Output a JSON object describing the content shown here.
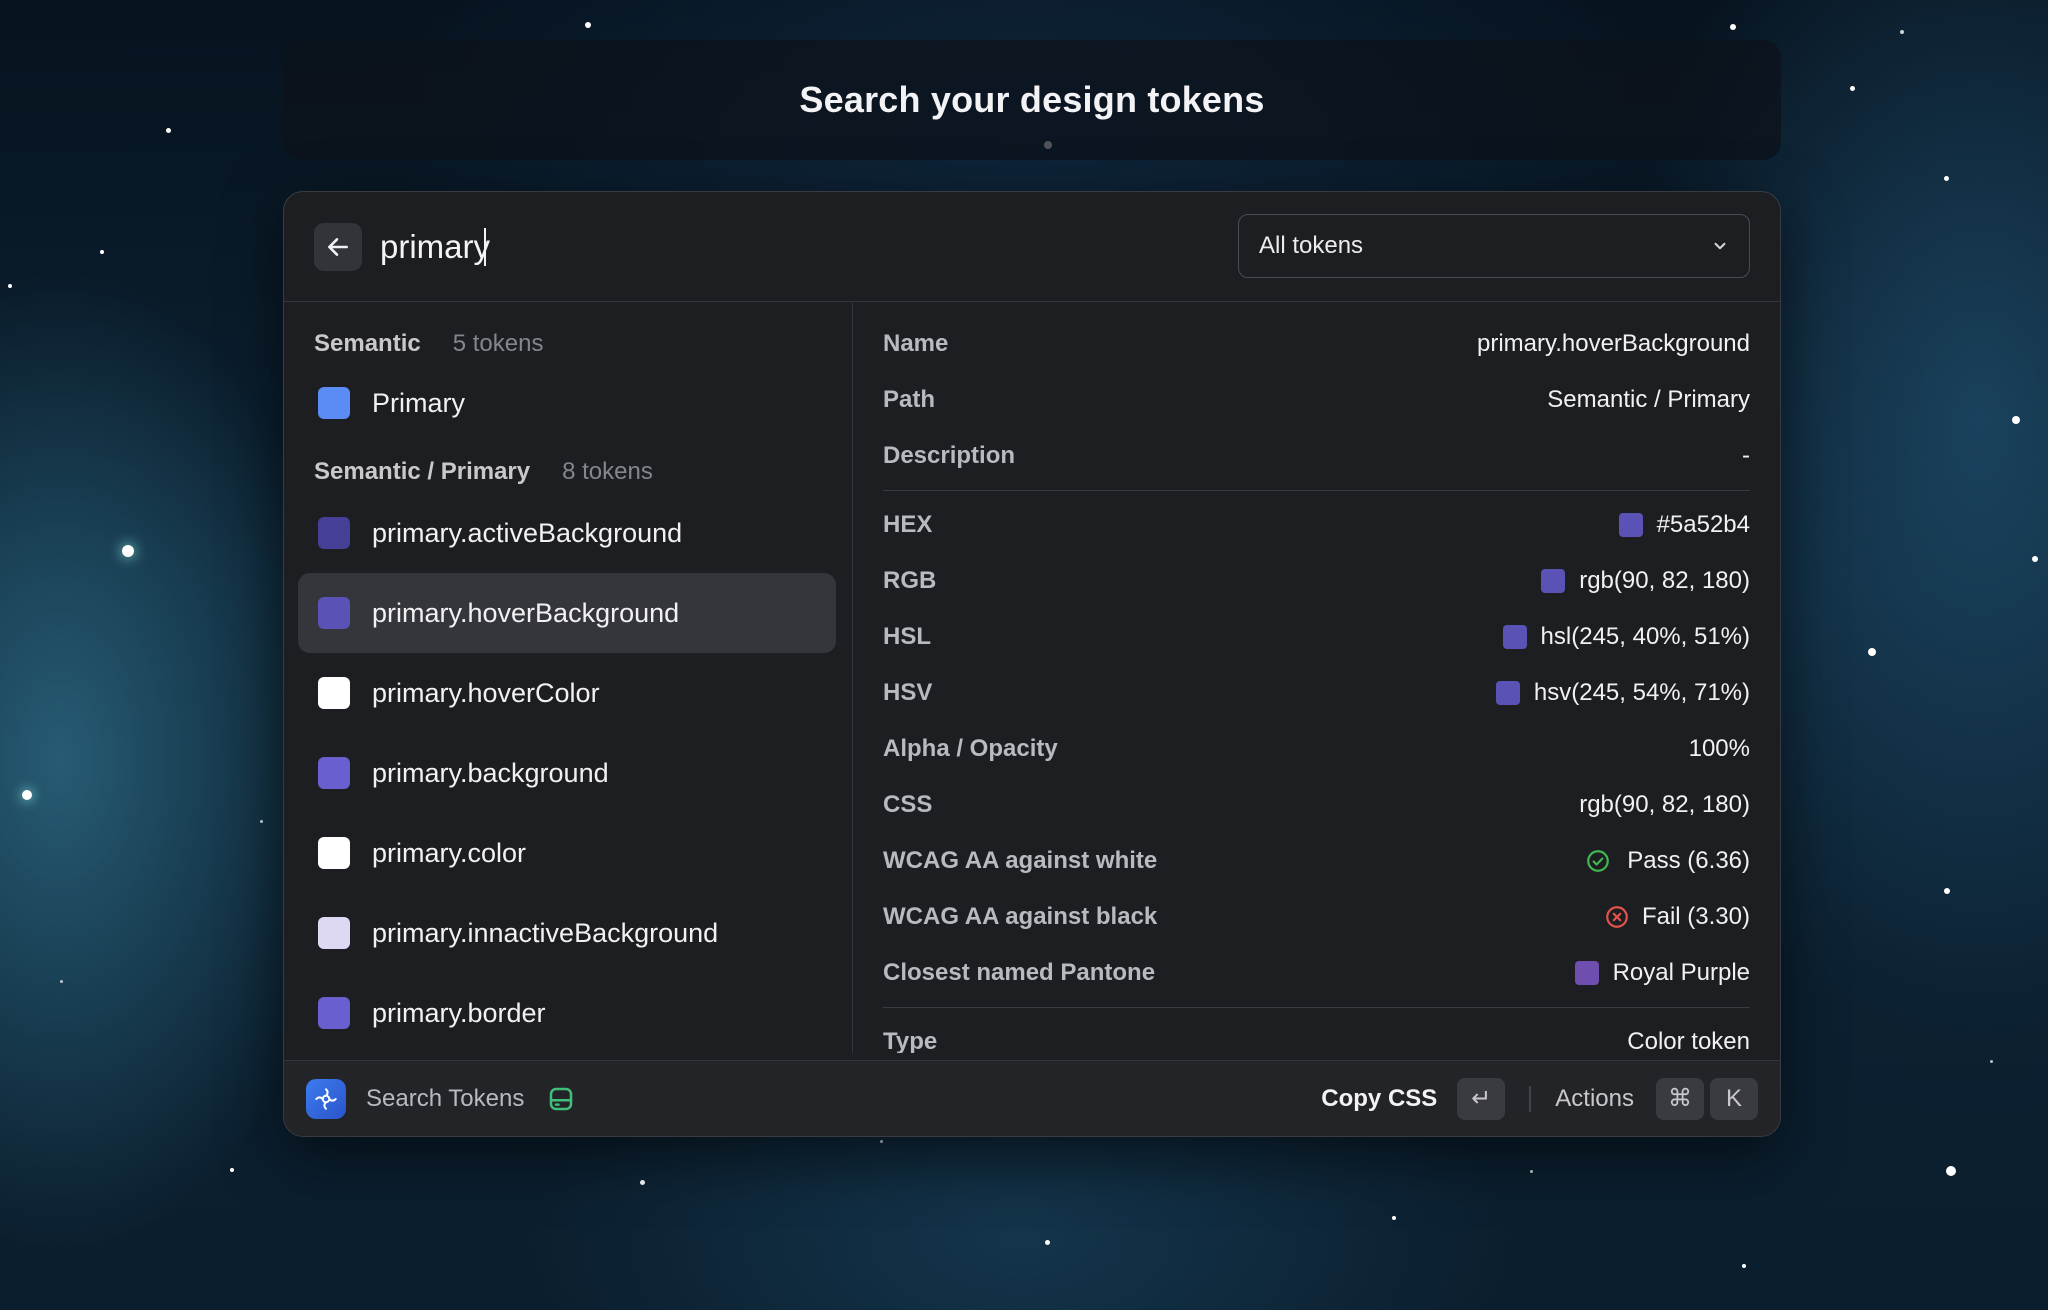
{
  "title": "Search your design tokens",
  "search": {
    "value": "primary"
  },
  "filter": {
    "selected": "All tokens",
    "icon": "chevron-down-icon"
  },
  "groups": [
    {
      "name": "Semantic",
      "count": "5 tokens",
      "items": [
        {
          "label": "Primary",
          "color": "#5b8bf5"
        }
      ]
    },
    {
      "name": "Semantic / Primary",
      "count": "8 tokens",
      "items": [
        {
          "label": "primary.activeBackground",
          "color": "#463f96"
        },
        {
          "label": "primary.hoverBackground",
          "color": "#5a52b4",
          "selected": true
        },
        {
          "label": "primary.hoverColor",
          "color": "#ffffff"
        },
        {
          "label": "primary.background",
          "color": "#6a5fce"
        },
        {
          "label": "primary.color",
          "color": "#ffffff"
        },
        {
          "label": "primary.innactiveBackground",
          "color": "#ddd9f5"
        },
        {
          "label": "primary.border",
          "color": "#6a5fce"
        }
      ]
    }
  ],
  "details": {
    "name": {
      "label": "Name",
      "value": "primary.hoverBackground"
    },
    "path": {
      "label": "Path",
      "value": "Semantic / Primary"
    },
    "description": {
      "label": "Description",
      "value": "-"
    },
    "hex": {
      "label": "HEX",
      "value": "#5a52b4"
    },
    "rgb": {
      "label": "RGB",
      "value": "rgb(90, 82, 180)"
    },
    "hsl": {
      "label": "HSL",
      "value": "hsl(245, 40%, 51%)"
    },
    "hsv": {
      "label": "HSV",
      "value": "hsv(245, 54%, 71%)"
    },
    "alpha": {
      "label": "Alpha / Opacity",
      "value": "100%"
    },
    "css": {
      "label": "CSS",
      "value": "rgb(90, 82, 180)"
    },
    "wcag_white": {
      "label": "WCAG AA against white",
      "value": "Pass (6.36)",
      "status": "pass",
      "color": "#3fb950"
    },
    "wcag_black": {
      "label": "WCAG AA against black",
      "value": "Fail (3.30)",
      "status": "fail",
      "color": "#e5534b"
    },
    "pantone": {
      "label": "Closest named Pantone",
      "value": "Royal Purple",
      "color": "#6e4fb0"
    },
    "type": {
      "label": "Type",
      "value": "Color token"
    }
  },
  "footer": {
    "app_title": "Search Tokens",
    "primary_action": "Copy CSS",
    "primary_shortcut": "↵",
    "actions_label": "Actions",
    "actions_shortcut": [
      "⌘",
      "K"
    ]
  },
  "colors": {
    "accent": "#5a52b4",
    "window_bg": "#1d1e22",
    "selected_row": "#35363c"
  }
}
